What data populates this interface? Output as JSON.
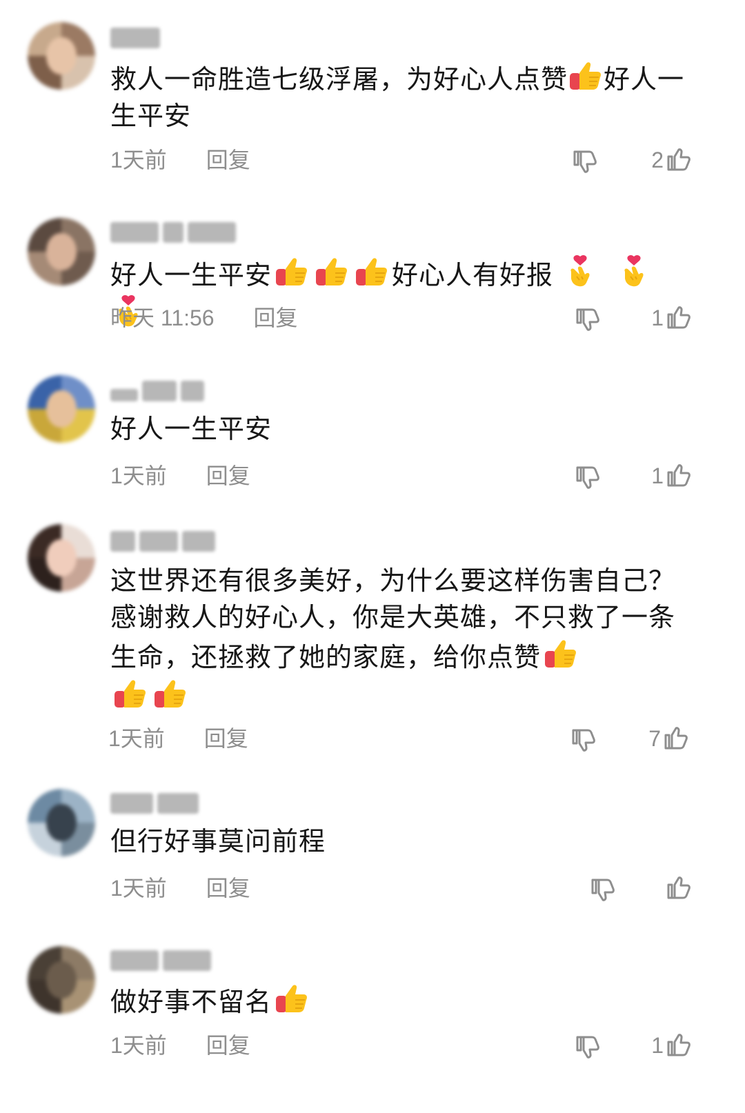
{
  "comments": [
    {
      "text_parts": [
        "救人一命胜造七级浮屠，为好心人点赞",
        "好人一生平安"
      ],
      "time": "1天前",
      "reply": "回复",
      "likes": "2",
      "icons": {
        "dislike": "thumbs-down-icon",
        "like": "thumbs-up-icon",
        "emoji": "thumbs-up-emoji"
      }
    },
    {
      "text_parts": [
        "好人一生平安",
        "好心人有好报"
      ],
      "time": "昨天 11:56",
      "reply": "回复",
      "likes": "1",
      "icons": {
        "dislike": "thumbs-down-icon",
        "like": "thumbs-up-icon",
        "emoji": "finger-heart-emoji"
      }
    },
    {
      "text_parts": [
        "好人一生平安"
      ],
      "time": "1天前",
      "reply": "回复",
      "likes": "1",
      "icons": {
        "dislike": "thumbs-down-icon",
        "like": "thumbs-up-icon"
      }
    },
    {
      "text_parts": [
        "这世界还有很多美好，为什么要这样伤害自己？感谢救人的好心人，你是大英雄，不只救了一条生命，还拯救了她的家庭，给你点赞"
      ],
      "time": "1天前",
      "reply": "回复",
      "likes": "7",
      "icons": {
        "dislike": "thumbs-down-icon",
        "like": "thumbs-up-icon",
        "emoji": "thumbs-up-emoji"
      }
    },
    {
      "text_parts": [
        "但行好事莫问前程"
      ],
      "time": "1天前",
      "reply": "回复",
      "likes": "",
      "icons": {
        "dislike": "thumbs-down-icon",
        "like": "thumbs-up-icon"
      }
    },
    {
      "text_parts": [
        "做好事不留名"
      ],
      "time": "1天前",
      "reply": "回复",
      "likes": "1",
      "icons": {
        "dislike": "thumbs-down-icon",
        "like": "thumbs-up-icon",
        "emoji": "thumbs-up-emoji"
      }
    }
  ],
  "colors": {
    "text": "#171717",
    "meta": "#8e8e8e",
    "background": "#ffffff"
  }
}
